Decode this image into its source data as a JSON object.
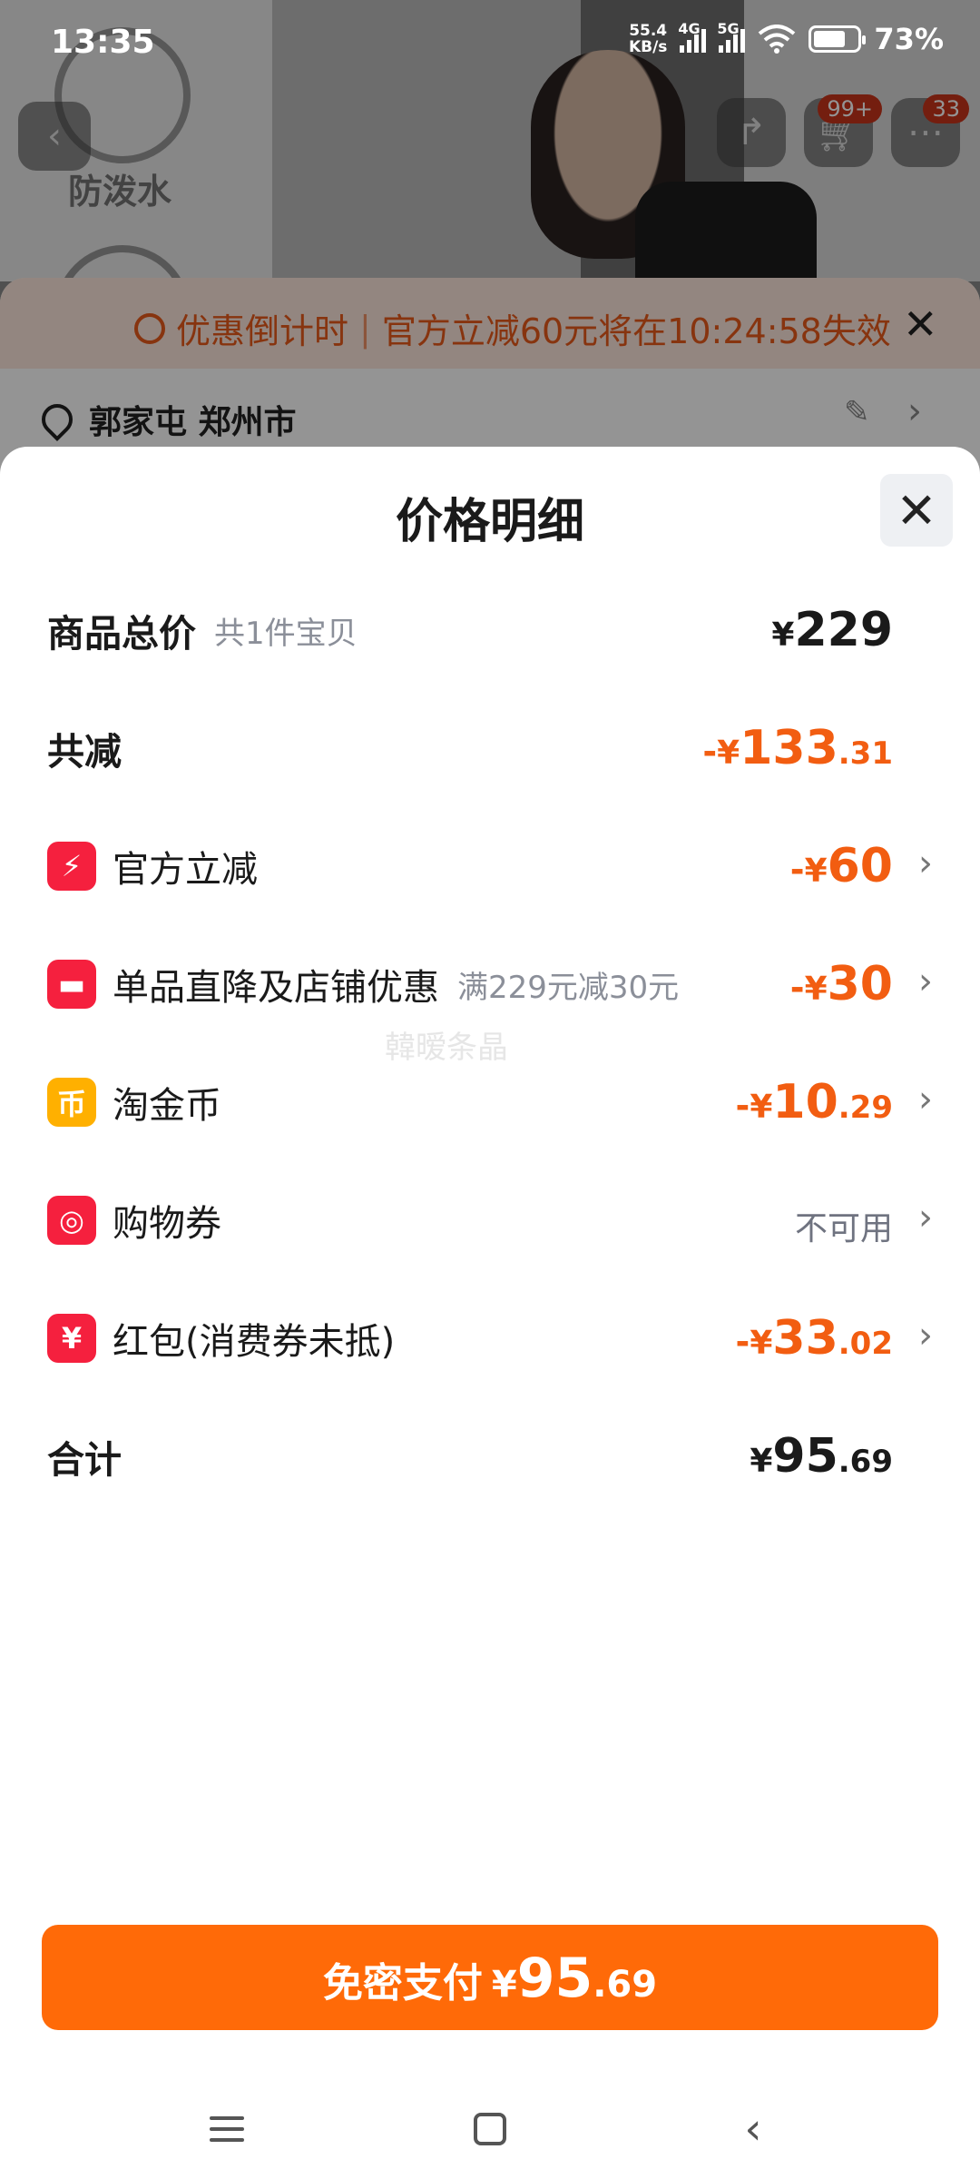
{
  "status_bar": {
    "time": "13:35",
    "net_speed_value": "55.4",
    "net_speed_unit": "KB/s",
    "net_type_1": "4G",
    "net_type_2": "5G",
    "battery_level": 0.73,
    "battery_percent": "73%"
  },
  "background_page": {
    "feature_label": "防泼水",
    "cart_badge": "99+",
    "message_badge": "33",
    "promo_label": "优惠倒计时",
    "promo_message": "官方立减60元将在10:24:58失效",
    "address": "郭家屯 郑州市"
  },
  "sheet": {
    "title": "价格明细",
    "rows": [
      {
        "label": "商品总价",
        "sub": "共1件宝贝",
        "sign": "",
        "yen": "¥",
        "int": "229",
        "dec": ""
      },
      {
        "label": "共减",
        "sign": "-",
        "yen": "¥",
        "int": "133",
        "dec": ".31"
      },
      {
        "label": "官方立减",
        "icon": "lightning-icon",
        "icon_color": "#f5203e",
        "sign": "-",
        "yen": "¥",
        "int": "60",
        "dec": ""
      },
      {
        "label": "单品直降及店铺优惠",
        "sub": "满229元减30元",
        "icon": "shop-icon",
        "icon_color": "#f5203e",
        "sign": "-",
        "yen": "¥",
        "int": "30",
        "dec": ""
      },
      {
        "label": "淘金币",
        "icon": "coin-icon",
        "icon_color": "#ffb000",
        "sign": "-",
        "yen": "¥",
        "int": "10",
        "dec": ".29"
      },
      {
        "label": "购物券",
        "icon": "voucher-icon",
        "icon_color": "#f5203e",
        "status": "不可用"
      },
      {
        "label": "红包(消费券未抵)",
        "icon": "red-packet-icon",
        "icon_color": "#f5203e",
        "sign": "-",
        "yen": "¥",
        "int": "33",
        "dec": ".02"
      },
      {
        "label": "合计",
        "sign": "",
        "yen": "¥",
        "int": "95",
        "dec": ".69"
      }
    ]
  },
  "watermark": "韓暧条晶",
  "pay_button": {
    "label": "免密支付",
    "yen": "¥",
    "int": "95",
    "dec": ".69"
  },
  "colors": {
    "accent": "#ff6a08",
    "discount": "#f25d11",
    "promo": "#e85a1a"
  }
}
